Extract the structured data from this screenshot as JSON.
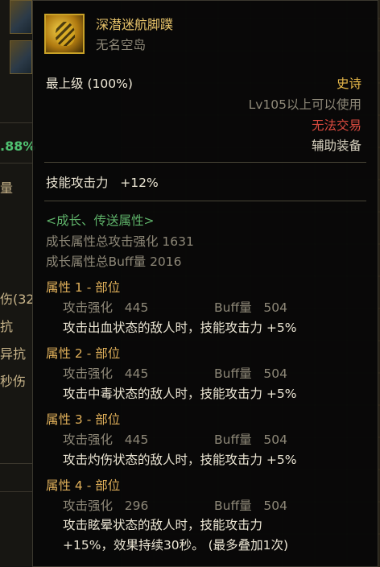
{
  "background": {
    "left_strip_texts": [
      ".88%",
      "量",
      "伤(32",
      "抗",
      "异抗",
      "秒伤"
    ]
  },
  "item": {
    "name": "深潜迷航脚蹼",
    "source": "无名空岛",
    "icon": "golden-flipper-icon",
    "grade_label": "最上级",
    "grade_value": "(100%)",
    "rarity": "史诗",
    "level_req": "Lv105以上可以使用",
    "trade": "无法交易",
    "type": "辅助装备",
    "skill_stat": "技能攻击力   +12%"
  },
  "growth": {
    "header": "<成长、传送属性>",
    "total_attack": "成长属性总攻击强化 1631",
    "total_buff": "成长属性总Buff量 2016"
  },
  "attributes": [
    {
      "header": "属性 1 - 部位",
      "stat_a": "攻击强化   445",
      "stat_b": "Buff量   504",
      "effect": "攻击出血状态的敌人时，技能攻击力 +5%"
    },
    {
      "header": "属性 2 - 部位",
      "stat_a": "攻击强化   445",
      "stat_b": "Buff量   504",
      "effect": "攻击中毒状态的敌人时，技能攻击力 +5%"
    },
    {
      "header": "属性 3 - 部位",
      "stat_a": "攻击强化   445",
      "stat_b": "Buff量   504",
      "effect": "攻击灼伤状态的敌人时，技能攻击力 +5%"
    },
    {
      "header": "属性 4 - 部位",
      "stat_a": "攻击强化   296",
      "stat_b": "Buff量   504",
      "effect": "攻击眩晕状态的敌人时，技能攻击力",
      "effect2": "+15%，效果持续30秒。 (最多叠加1次)"
    }
  ],
  "colors": {
    "title": "#e8c46a",
    "rarity_epic": "#e6b84a",
    "untradable": "#d94a3f",
    "growth": "#5fb36a",
    "attr_header": "#e0b05a"
  }
}
